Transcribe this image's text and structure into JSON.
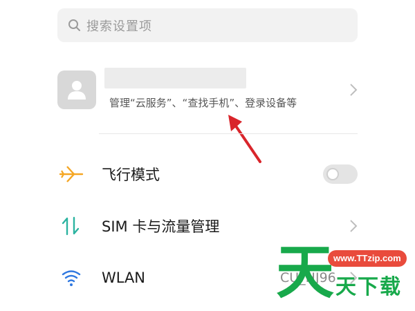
{
  "search": {
    "placeholder": "搜索设置项",
    "icon": "search-icon"
  },
  "account": {
    "subtitle": "管理“云服务”、“查找手机”、登录设备等",
    "avatar_icon": "person-icon"
  },
  "settings": {
    "items": [
      {
        "label": "飞行模式",
        "icon": "airplane-icon",
        "control": "toggle",
        "toggle_on": false
      },
      {
        "label": "SIM 卡与流量管理",
        "icon": "data-arrows-icon",
        "control": "chevron"
      },
      {
        "label": "WLAN",
        "icon": "wifi-icon",
        "control": "chevron",
        "value": "CU_HJ96"
      }
    ]
  },
  "annotation": {
    "arrow_color": "#d9252b"
  },
  "watermark": {
    "site": "www.TTzip.com",
    "big_char": "天",
    "text": "天下载"
  },
  "colors": {
    "accent_orange": "#f5a623",
    "accent_teal": "#2bb3a0",
    "accent_blue": "#2f78e0",
    "watermark_green": "#18a94b",
    "watermark_red": "#e94b3c"
  }
}
